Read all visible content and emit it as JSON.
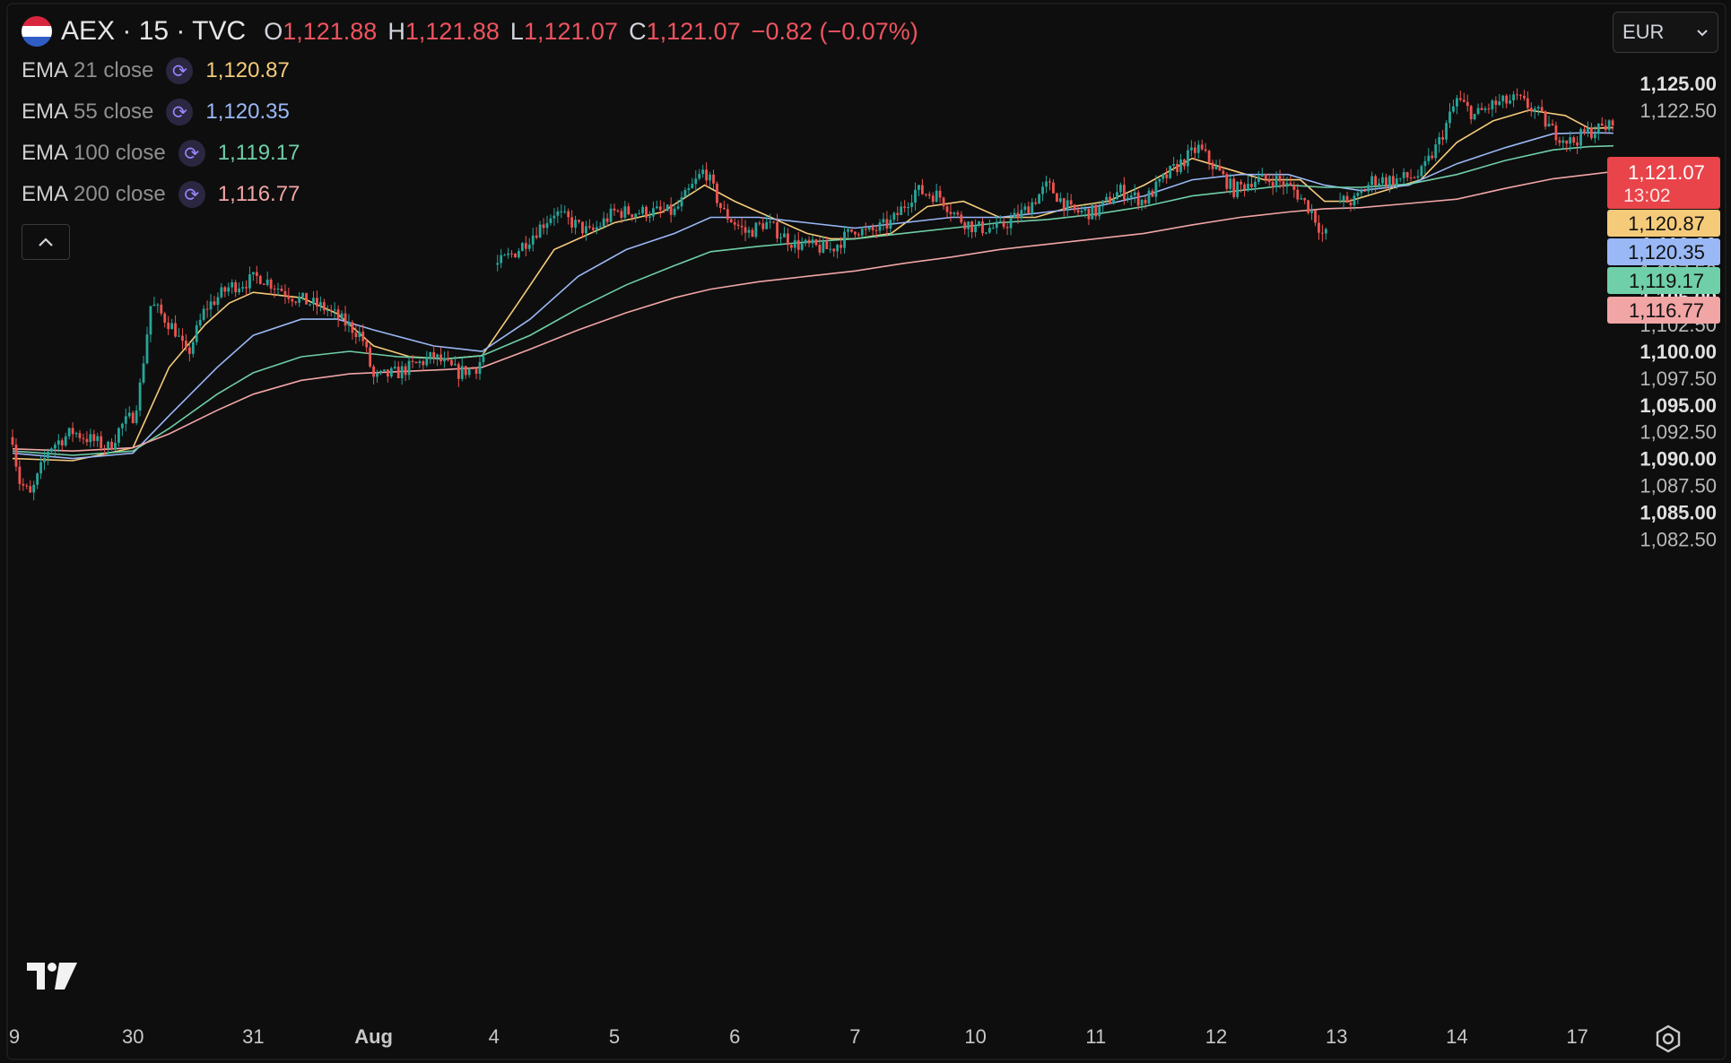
{
  "header": {
    "symbol": "AEX · 15 · TVC",
    "o_label": "O",
    "o": "1,121.88",
    "h_label": "H",
    "h": "1,121.88",
    "l_label": "L",
    "l": "1,121.07",
    "c_label": "C",
    "c": "1,121.07",
    "change": "−0.82 (−0.07%)"
  },
  "indicators": [
    {
      "name": "EMA",
      "param": "21 close",
      "value": "1,120.87",
      "color": "#f5cb7a"
    },
    {
      "name": "EMA",
      "param": "55 close",
      "value": "1,120.35",
      "color": "#9ab8f6"
    },
    {
      "name": "EMA",
      "param": "100 close",
      "value": "1,119.17",
      "color": "#6fcfa8"
    },
    {
      "name": "EMA",
      "param": "200 close",
      "value": "1,116.77",
      "color": "#f2a5a5"
    }
  ],
  "currency": "EUR",
  "icons": {
    "refresh": "refresh-icon",
    "collapse": "chevron-up-icon",
    "dropdown": "chevron-down-icon",
    "logo": "tradingview-logo",
    "settings": "settings-icon"
  },
  "colors": {
    "up": "#26a69a",
    "down": "#ef5350",
    "background": "#0e0e0e",
    "axis_text": "#d1d4dc"
  },
  "chart_data": {
    "type": "candlestick",
    "ylim": [
      1081.5,
      1126.5
    ],
    "y_ticks": [
      {
        "v": 1125.0,
        "label": "1,125.00",
        "bold": true
      },
      {
        "v": 1122.5,
        "label": "1,122.50",
        "bold": false
      },
      {
        "v": 1112.5,
        "label": "1,112.50",
        "bold": false
      },
      {
        "v": 1110.0,
        "label": "1,110.00",
        "bold": true
      },
      {
        "v": 1107.5,
        "label": "1,107.50",
        "bold": false
      },
      {
        "v": 1105.0,
        "label": "1,105.00",
        "bold": true
      },
      {
        "v": 1102.5,
        "label": "1,102.50",
        "bold": false
      },
      {
        "v": 1100.0,
        "label": "1,100.00",
        "bold": true
      },
      {
        "v": 1097.5,
        "label": "1,097.50",
        "bold": false
      },
      {
        "v": 1095.0,
        "label": "1,095.00",
        "bold": true
      },
      {
        "v": 1092.5,
        "label": "1,092.50",
        "bold": false
      },
      {
        "v": 1090.0,
        "label": "1,090.00",
        "bold": true
      },
      {
        "v": 1087.5,
        "label": "1,087.50",
        "bold": false
      },
      {
        "v": 1085.0,
        "label": "1,085.00",
        "bold": true
      },
      {
        "v": 1082.5,
        "label": "1,082.50",
        "bold": false
      }
    ],
    "x_ticks": [
      {
        "session": 0,
        "label": "9",
        "bold": false
      },
      {
        "session": 1,
        "label": "30",
        "bold": false
      },
      {
        "session": 2,
        "label": "31",
        "bold": false
      },
      {
        "session": 3,
        "label": "Aug",
        "bold": true
      },
      {
        "session": 4,
        "label": "4",
        "bold": false
      },
      {
        "session": 5,
        "label": "5",
        "bold": false
      },
      {
        "session": 6,
        "label": "6",
        "bold": false
      },
      {
        "session": 7,
        "label": "7",
        "bold": false
      },
      {
        "session": 8,
        "label": "10",
        "bold": false
      },
      {
        "session": 9,
        "label": "11",
        "bold": false
      },
      {
        "session": 10,
        "label": "12",
        "bold": false
      },
      {
        "session": 11,
        "label": "13",
        "bold": false
      },
      {
        "session": 12,
        "label": "14",
        "bold": false
      },
      {
        "session": 13,
        "label": "17",
        "bold": false
      }
    ],
    "price_path": [
      [
        0,
        1092
      ],
      [
        0.05,
        1088
      ],
      [
        0.15,
        1086.5
      ],
      [
        0.3,
        1091
      ],
      [
        0.5,
        1092.5
      ],
      [
        0.8,
        1091
      ],
      [
        0.9,
        1093
      ],
      [
        1.0,
        1094
      ],
      [
        1.05,
        1096
      ],
      [
        1.15,
        1104.5
      ],
      [
        1.35,
        1102
      ],
      [
        1.45,
        1099.5
      ],
      [
        1.6,
        1104
      ],
      [
        1.8,
        1106
      ],
      [
        1.95,
        1106.5
      ],
      [
        2.05,
        1107
      ],
      [
        2.2,
        1106
      ],
      [
        2.35,
        1105
      ],
      [
        2.6,
        1104
      ],
      [
        2.9,
        1101.5
      ],
      [
        3.0,
        1097.5
      ],
      [
        3.2,
        1098
      ],
      [
        3.5,
        1099.5
      ],
      [
        3.7,
        1098
      ],
      [
        3.85,
        1098.5
      ],
      [
        4.0,
        1101
      ],
      [
        4.02,
        1108
      ],
      [
        4.2,
        1109.5
      ],
      [
        4.5,
        1113
      ],
      [
        4.8,
        1111
      ],
      [
        5.0,
        1113
      ],
      [
        5.2,
        1113
      ],
      [
        5.5,
        1113
      ],
      [
        5.75,
        1117
      ],
      [
        5.9,
        1113
      ],
      [
        6.1,
        1111
      ],
      [
        6.25,
        1112
      ],
      [
        6.5,
        1110
      ],
      [
        6.8,
        1109.5
      ],
      [
        7.0,
        1111.5
      ],
      [
        7.1,
        1111
      ],
      [
        7.3,
        1112
      ],
      [
        7.5,
        1115
      ],
      [
        7.7,
        1114.5
      ],
      [
        7.85,
        1112.5
      ],
      [
        8.0,
        1111.5
      ],
      [
        8.2,
        1111.5
      ],
      [
        8.4,
        1113
      ],
      [
        8.6,
        1115.5
      ],
      [
        8.8,
        1113
      ],
      [
        9.0,
        1113
      ],
      [
        9.2,
        1115
      ],
      [
        9.4,
        1114
      ],
      [
        9.6,
        1116.5
      ],
      [
        9.85,
        1119
      ],
      [
        10.0,
        1117
      ],
      [
        10.15,
        1115
      ],
      [
        10.3,
        1116
      ],
      [
        10.5,
        1116
      ],
      [
        10.65,
        1115
      ],
      [
        10.8,
        1113
      ],
      [
        10.9,
        1110.5
      ],
      [
        11.0,
        1114
      ],
      [
        11.15,
        1114
      ],
      [
        11.3,
        1116
      ],
      [
        11.5,
        1116
      ],
      [
        11.7,
        1116.5
      ],
      [
        11.85,
        1119.5
      ],
      [
        12.0,
        1123.5
      ],
      [
        12.15,
        1122
      ],
      [
        12.3,
        1123
      ],
      [
        12.5,
        1123.5
      ],
      [
        12.65,
        1122.5
      ],
      [
        12.8,
        1120.5
      ],
      [
        12.95,
        1119.5
      ],
      [
        13.1,
        1120.5
      ],
      [
        13.3,
        1121.07
      ]
    ],
    "gaps": [
      [
        3.92,
        4.0
      ],
      [
        10.93,
        11.0
      ]
    ],
    "pre_shown_from": 0.0,
    "last_price": {
      "value": 1121.07,
      "label": "1,121.07",
      "countdown": "13:02",
      "color": "#e8444a"
    },
    "ema_series": [
      {
        "name": "EMA 21 close",
        "color": "#f5cb7a",
        "value": 1120.87,
        "label": "1,120.87",
        "points": [
          [
            0,
            1090
          ],
          [
            0.5,
            1089.8
          ],
          [
            1.0,
            1091
          ],
          [
            1.3,
            1098.5
          ],
          [
            1.6,
            1102.5
          ],
          [
            1.8,
            1104.5
          ],
          [
            2.0,
            1105.5
          ],
          [
            2.4,
            1105
          ],
          [
            2.7,
            1103.5
          ],
          [
            3.0,
            1100.5
          ],
          [
            3.3,
            1099.5
          ],
          [
            3.6,
            1099.3
          ],
          [
            3.9,
            1099.6
          ],
          [
            4.2,
            1104.5
          ],
          [
            4.5,
            1109.5
          ],
          [
            4.8,
            1111
          ],
          [
            5.0,
            1112
          ],
          [
            5.4,
            1113
          ],
          [
            5.75,
            1115.5
          ],
          [
            6.0,
            1114
          ],
          [
            6.3,
            1112.5
          ],
          [
            6.6,
            1111
          ],
          [
            6.8,
            1110.5
          ],
          [
            7.0,
            1110.5
          ],
          [
            7.3,
            1111
          ],
          [
            7.6,
            1113.5
          ],
          [
            7.9,
            1114
          ],
          [
            8.2,
            1112.5
          ],
          [
            8.5,
            1112.5
          ],
          [
            8.8,
            1113.5
          ],
          [
            9.1,
            1114
          ],
          [
            9.4,
            1115.5
          ],
          [
            9.8,
            1118
          ],
          [
            10.1,
            1117
          ],
          [
            10.4,
            1116
          ],
          [
            10.7,
            1116
          ],
          [
            10.9,
            1114
          ],
          [
            11.1,
            1114
          ],
          [
            11.4,
            1115
          ],
          [
            11.7,
            1116
          ],
          [
            12.0,
            1119.5
          ],
          [
            12.3,
            1121.5
          ],
          [
            12.6,
            1122.5
          ],
          [
            12.9,
            1122
          ],
          [
            13.1,
            1120.8
          ],
          [
            13.3,
            1120.87
          ]
        ]
      },
      {
        "name": "EMA 55 close",
        "color": "#9ab8f6",
        "value": 1120.35,
        "label": "1,120.35",
        "points": [
          [
            0,
            1090.5
          ],
          [
            0.5,
            1090
          ],
          [
            1.0,
            1090.5
          ],
          [
            1.3,
            1094
          ],
          [
            1.7,
            1098.5
          ],
          [
            2.0,
            1101.5
          ],
          [
            2.4,
            1103
          ],
          [
            2.7,
            1103
          ],
          [
            3.0,
            1102
          ],
          [
            3.5,
            1100.5
          ],
          [
            3.9,
            1100
          ],
          [
            4.3,
            1103
          ],
          [
            4.7,
            1107
          ],
          [
            5.1,
            1109.5
          ],
          [
            5.5,
            1111
          ],
          [
            5.8,
            1112.5
          ],
          [
            6.2,
            1112.5
          ],
          [
            6.6,
            1112
          ],
          [
            7.0,
            1111.5
          ],
          [
            7.4,
            1112
          ],
          [
            7.8,
            1112.5
          ],
          [
            8.2,
            1112.5
          ],
          [
            8.6,
            1113
          ],
          [
            9.0,
            1113.5
          ],
          [
            9.4,
            1114.5
          ],
          [
            9.8,
            1116
          ],
          [
            10.2,
            1116.5
          ],
          [
            10.6,
            1116.5
          ],
          [
            10.9,
            1115.5
          ],
          [
            11.2,
            1115
          ],
          [
            11.6,
            1115.5
          ],
          [
            12.0,
            1117.5
          ],
          [
            12.4,
            1119
          ],
          [
            12.8,
            1120.3
          ],
          [
            13.1,
            1120.4
          ],
          [
            13.3,
            1120.35
          ]
        ]
      },
      {
        "name": "EMA 100 close",
        "color": "#6fcfa8",
        "value": 1119.17,
        "label": "1,119.17",
        "points": [
          [
            0,
            1090.7
          ],
          [
            0.5,
            1090.3
          ],
          [
            1.0,
            1090.7
          ],
          [
            1.3,
            1092.8
          ],
          [
            1.7,
            1096
          ],
          [
            2.0,
            1098
          ],
          [
            2.4,
            1099.5
          ],
          [
            2.8,
            1100
          ],
          [
            3.2,
            1099.5
          ],
          [
            3.6,
            1099.3
          ],
          [
            3.9,
            1099.6
          ],
          [
            4.3,
            1101.5
          ],
          [
            4.7,
            1104
          ],
          [
            5.1,
            1106.2
          ],
          [
            5.5,
            1108
          ],
          [
            5.8,
            1109.3
          ],
          [
            6.2,
            1109.8
          ],
          [
            6.6,
            1110.2
          ],
          [
            7.0,
            1110.5
          ],
          [
            7.4,
            1111
          ],
          [
            7.8,
            1111.5
          ],
          [
            8.2,
            1112
          ],
          [
            8.6,
            1112.3
          ],
          [
            9.0,
            1112.8
          ],
          [
            9.4,
            1113.5
          ],
          [
            9.8,
            1114.5
          ],
          [
            10.2,
            1115
          ],
          [
            10.6,
            1115.5
          ],
          [
            10.9,
            1115.3
          ],
          [
            11.2,
            1115.3
          ],
          [
            11.6,
            1115.6
          ],
          [
            12.0,
            1116.5
          ],
          [
            12.4,
            1117.8
          ],
          [
            12.8,
            1118.8
          ],
          [
            13.1,
            1119.1
          ],
          [
            13.3,
            1119.17
          ]
        ]
      },
      {
        "name": "EMA 200 close",
        "color": "#f2a5a5",
        "value": 1116.77,
        "label": "1,116.77",
        "points": [
          [
            0,
            1090.9
          ],
          [
            0.5,
            1090.7
          ],
          [
            1.0,
            1091
          ],
          [
            1.3,
            1092.3
          ],
          [
            1.7,
            1094.5
          ],
          [
            2.0,
            1096
          ],
          [
            2.4,
            1097.3
          ],
          [
            2.8,
            1097.9
          ],
          [
            3.2,
            1098.1
          ],
          [
            3.6,
            1098.3
          ],
          [
            3.9,
            1098.5
          ],
          [
            4.3,
            1100.2
          ],
          [
            4.7,
            1102
          ],
          [
            5.1,
            1103.6
          ],
          [
            5.5,
            1105
          ],
          [
            5.8,
            1105.8
          ],
          [
            6.2,
            1106.5
          ],
          [
            6.6,
            1107
          ],
          [
            7.0,
            1107.5
          ],
          [
            7.4,
            1108.2
          ],
          [
            7.8,
            1108.8
          ],
          [
            8.2,
            1109.5
          ],
          [
            8.6,
            1110
          ],
          [
            9.0,
            1110.5
          ],
          [
            9.4,
            1111
          ],
          [
            9.8,
            1111.8
          ],
          [
            10.2,
            1112.5
          ],
          [
            10.6,
            1113
          ],
          [
            10.9,
            1113.3
          ],
          [
            11.2,
            1113.4
          ],
          [
            11.6,
            1113.8
          ],
          [
            12.0,
            1114.2
          ],
          [
            12.4,
            1115.2
          ],
          [
            12.8,
            1116.1
          ],
          [
            13.1,
            1116.5
          ],
          [
            13.3,
            1116.77
          ]
        ]
      }
    ]
  }
}
